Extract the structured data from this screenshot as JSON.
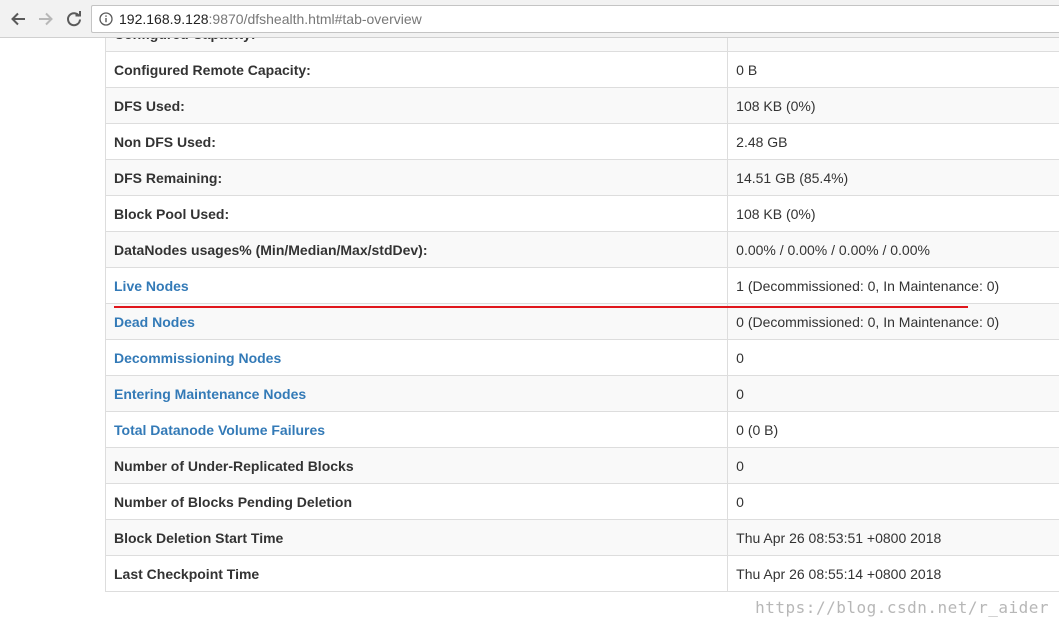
{
  "browser": {
    "url_host": "192.168.9.128",
    "url_rest": ":9870/dfshealth.html#tab-overview"
  },
  "overview": {
    "rows": [
      {
        "label": "Configured Capacity:",
        "value": "",
        "link": false
      },
      {
        "label": "Configured Remote Capacity:",
        "value": "0 B",
        "link": false
      },
      {
        "label": "DFS Used:",
        "value": "108 KB (0%)",
        "link": false
      },
      {
        "label": "Non DFS Used:",
        "value": "2.48 GB",
        "link": false
      },
      {
        "label": "DFS Remaining:",
        "value": "14.51 GB (85.4%)",
        "link": false
      },
      {
        "label": "Block Pool Used:",
        "value": "108 KB (0%)",
        "link": false
      },
      {
        "label": "DataNodes usages% (Min/Median/Max/stdDev):",
        "value": "0.00% / 0.00% / 0.00% / 0.00%",
        "link": false
      },
      {
        "label": "Live Nodes",
        "value": "1 (Decommissioned: 0, In Maintenance: 0)",
        "link": true
      },
      {
        "label": "Dead Nodes",
        "value": "0 (Decommissioned: 0, In Maintenance: 0)",
        "link": true
      },
      {
        "label": "Decommissioning Nodes",
        "value": "0",
        "link": true
      },
      {
        "label": "Entering Maintenance Nodes",
        "value": "0",
        "link": true
      },
      {
        "label": "Total Datanode Volume Failures",
        "value": "0 (0 B)",
        "link": true
      },
      {
        "label": "Number of Under-Replicated Blocks",
        "value": "0",
        "link": false
      },
      {
        "label": "Number of Blocks Pending Deletion",
        "value": "0",
        "link": false
      },
      {
        "label": "Block Deletion Start Time",
        "value": "Thu Apr 26 08:53:51 +0800 2018",
        "link": false
      },
      {
        "label": "Last Checkpoint Time",
        "value": "Thu Apr 26 08:55:14 +0800 2018",
        "link": false
      }
    ]
  },
  "watermark": "https://blog.csdn.net/r_aider",
  "colors": {
    "link": "#337ab7",
    "annotation": "#e0161c"
  }
}
